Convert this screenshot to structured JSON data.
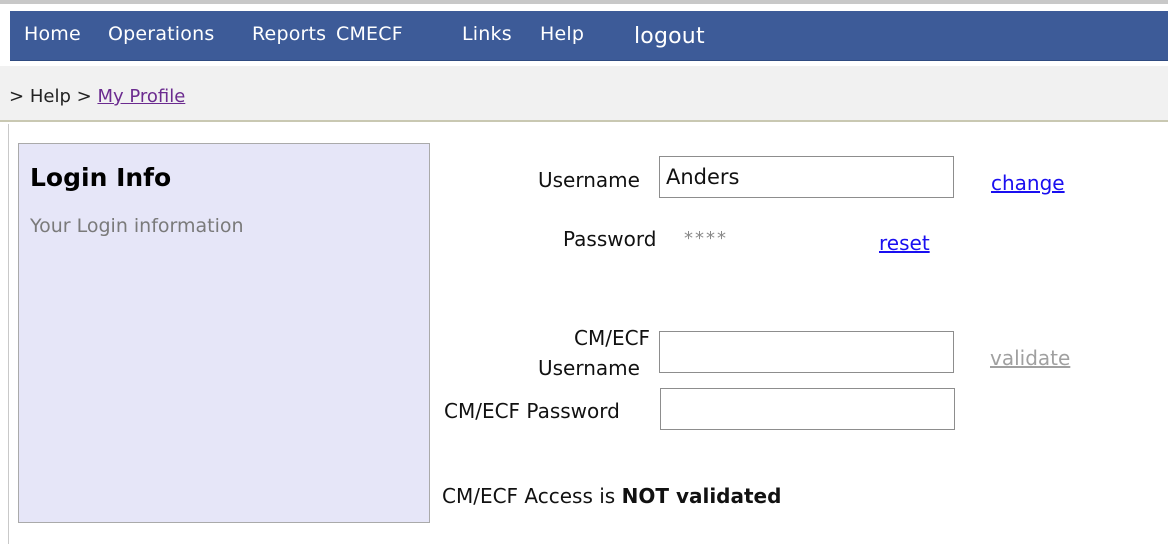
{
  "nav": {
    "items": [
      "Home",
      "Operations",
      "Reports",
      "CMECF",
      "Links",
      "Help"
    ],
    "logout": "logout"
  },
  "breadcrumb": {
    "sep1": ">",
    "item1": "Help",
    "sep2": ">",
    "current": "My Profile"
  },
  "panel": {
    "title": "Login Info",
    "subtitle": "Your Login information"
  },
  "form": {
    "username_label": "Username",
    "username_value": "Anders",
    "change_link": "change",
    "password_label": "Password",
    "password_masked": "****",
    "reset_link": "reset",
    "cmecf_user_label_line1": "CM/ECF",
    "cmecf_user_label_line2": "Username",
    "cmecf_user_value": "",
    "validate_link": "validate",
    "cmecf_pass_label": "CM/ECF Password",
    "cmecf_pass_value": "",
    "access_prefix": "CM/ECF Access is",
    "access_status": "NOT validated"
  },
  "colors": {
    "nav_bg": "#3d5b98",
    "panel_bg": "#e6e6f8",
    "link": "#1a0ff0",
    "visited_link": "#6b2b8f"
  }
}
